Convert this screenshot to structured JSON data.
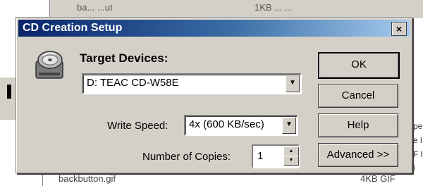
{
  "background": {
    "top_text": "ba... ...ut",
    "top_text2": "1KB  ...  ...",
    "bottom_text": "backbutton.gif",
    "bottom_text2": "4KB  GIF",
    "right_lines": [
      "pe",
      "e l",
      "F l",
      "l"
    ]
  },
  "dialog": {
    "title": "CD Creation Setup",
    "close_label": "×",
    "target_label": "Target Devices:",
    "device_value": "D: TEAC  CD-W58E",
    "speed_label": "Write Speed:",
    "speed_value": "4x (600 KB/sec)",
    "copies_label": "Number of Copies:",
    "copies_value": "1",
    "buttons": {
      "ok": "OK",
      "cancel": "Cancel",
      "help": "Help",
      "advanced": "Advanced >>"
    }
  },
  "icons": {
    "cd_drive": "cd-drive-icon",
    "dropdown_arrow": "chevron-down-icon",
    "spin_up": "spin-up-icon",
    "spin_down": "spin-down-icon"
  },
  "colors": {
    "title_start": "#0a246a",
    "title_end": "#a6caf0",
    "face": "#d4d0c8"
  }
}
